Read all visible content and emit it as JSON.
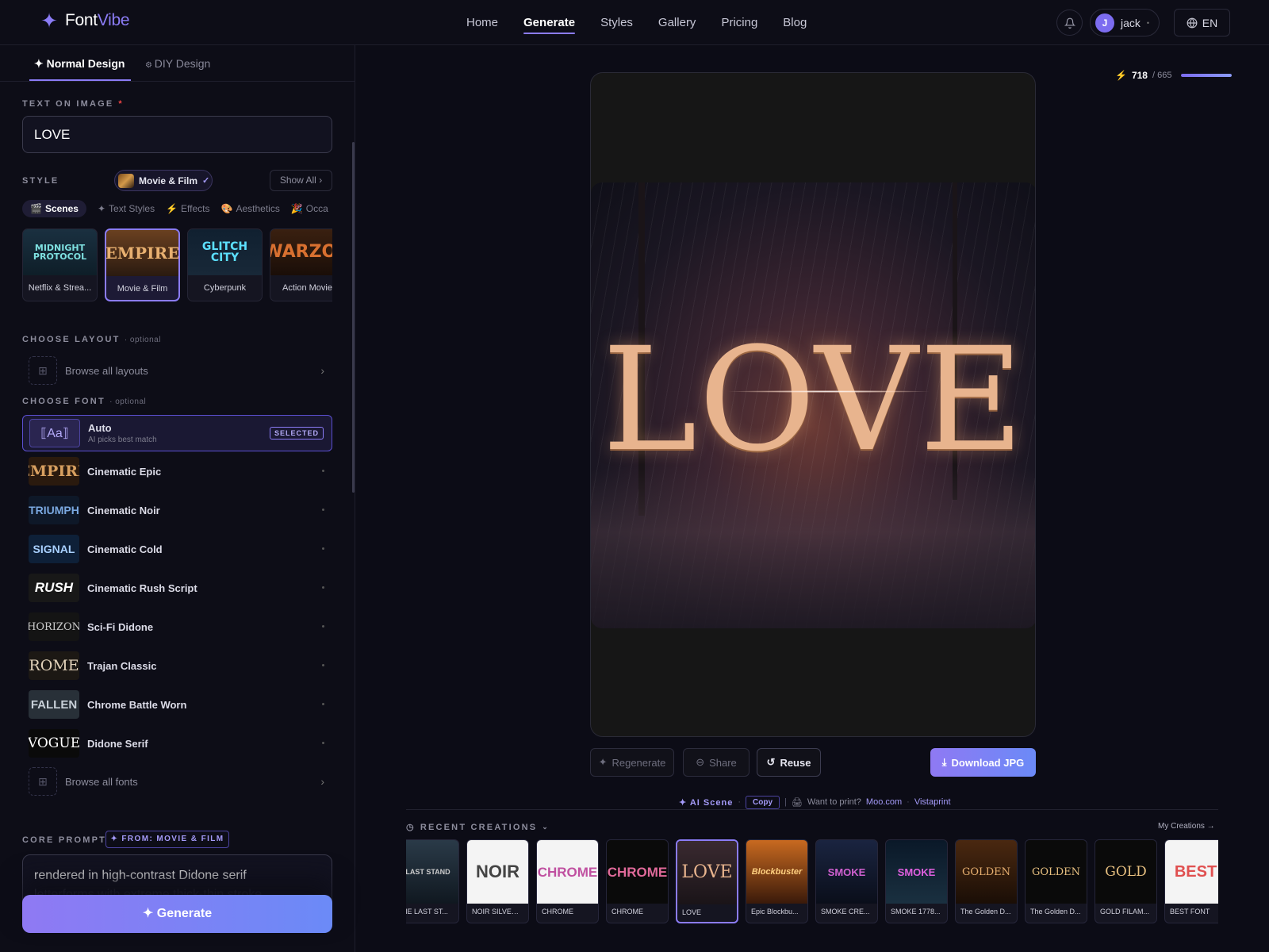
{
  "brand": {
    "name_a": "Font",
    "name_b": "Vibe"
  },
  "nav": {
    "items": [
      "Home",
      "Generate",
      "Styles",
      "Gallery",
      "Pricing",
      "Blog"
    ],
    "active": "Generate"
  },
  "user": {
    "initial": "J",
    "name": "jack"
  },
  "lang": "EN",
  "sidebar": {
    "tabs": [
      "Normal Design",
      "DIY Design"
    ],
    "text_label": "TEXT ON IMAGE",
    "text_required": "*",
    "text_value": "LOVE",
    "style_label": "STYLE",
    "style_selected": "Movie & Film",
    "show_all": "Show All",
    "subtabs": [
      "Scenes",
      "Text Styles",
      "Effects",
      "Aesthetics",
      "Occa"
    ],
    "cards": [
      {
        "art": "MIDNIGHT PROTOCOL",
        "label": "Netflix & Strea..."
      },
      {
        "art": "EMPIRE",
        "label": "Movie & Film"
      },
      {
        "art": "GLITCH CITY",
        "label": "Cyberpunk"
      },
      {
        "art": "WARZON",
        "label": "Action Movie"
      }
    ],
    "layout_label": "CHOOSE LAYOUT",
    "layout_optional": "· optional",
    "browse_layouts": "Browse all layouts",
    "font_label": "CHOOSE FONT",
    "font_optional": "· optional",
    "auto_font": {
      "name": "Auto",
      "sub": "AI picks best match",
      "badge": "SELECTED"
    },
    "fonts": [
      {
        "thumb": "EMPIRE",
        "name": "Cinematic Epic"
      },
      {
        "thumb": "TRIUMPH",
        "name": "Cinematic Noir"
      },
      {
        "thumb": "SIGNAL",
        "name": "Cinematic Cold"
      },
      {
        "thumb": "RUSH",
        "name": "Cinematic Rush Script"
      },
      {
        "thumb": "HORIZON",
        "name": "Sci-Fi Didone"
      },
      {
        "thumb": "ROME",
        "name": "Trajan Classic"
      },
      {
        "thumb": "FALLEN",
        "name": "Chrome Battle Worn"
      },
      {
        "thumb": "VOGUE",
        "name": "Didone Serif"
      }
    ],
    "browse_fonts": "Browse all fonts",
    "prompt_label": "CORE PROMPT",
    "prompt_from": "✦ FROM: MOVIE & FILM",
    "prompt_line1": "rendered in high-contrast Didone serif",
    "prompt_line2": "letterforms with extreme thick-thin stroke",
    "generate": "✦ Generate"
  },
  "credits": {
    "used": "718",
    "total": "/ 665",
    "fill_percent": 100
  },
  "preview": {
    "art_text": "LOVE"
  },
  "actions": {
    "regenerate": "Regenerate",
    "share": "Share",
    "reuse": "Reuse",
    "download": "Download JPG"
  },
  "meta": {
    "ai_scene": "✦ AI Scene",
    "copy": "Copy",
    "want_print": "Want to print?",
    "moo": "Moo.com",
    "vistaprint": "Vistaprint"
  },
  "recent": {
    "label": "RECENT CREATIONS",
    "my_creations": "My Creations →",
    "items": [
      {
        "art": "LAST STAND",
        "label": "HE LAST ST..."
      },
      {
        "art": "NOIR",
        "label": "NOIR SILVER ..."
      },
      {
        "art": "CHROME",
        "label": "CHROME"
      },
      {
        "art": "CHROME",
        "label": "CHROME"
      },
      {
        "art": "LOVE",
        "label": "LOVE"
      },
      {
        "art": "Blockbuster",
        "label": "Epic Blockbu..."
      },
      {
        "art": "SMOKE",
        "label": "SMOKE CRE..."
      },
      {
        "art": "SMOKE",
        "label": "SMOKE 1778..."
      },
      {
        "art": "GOLDEN",
        "label": "The Golden D..."
      },
      {
        "art": "GOLDEN",
        "label": "The Golden D..."
      },
      {
        "art": "GOLD",
        "label": "GOLD FILAM..."
      },
      {
        "art": "BEST",
        "label": "BEST FONT"
      }
    ]
  }
}
